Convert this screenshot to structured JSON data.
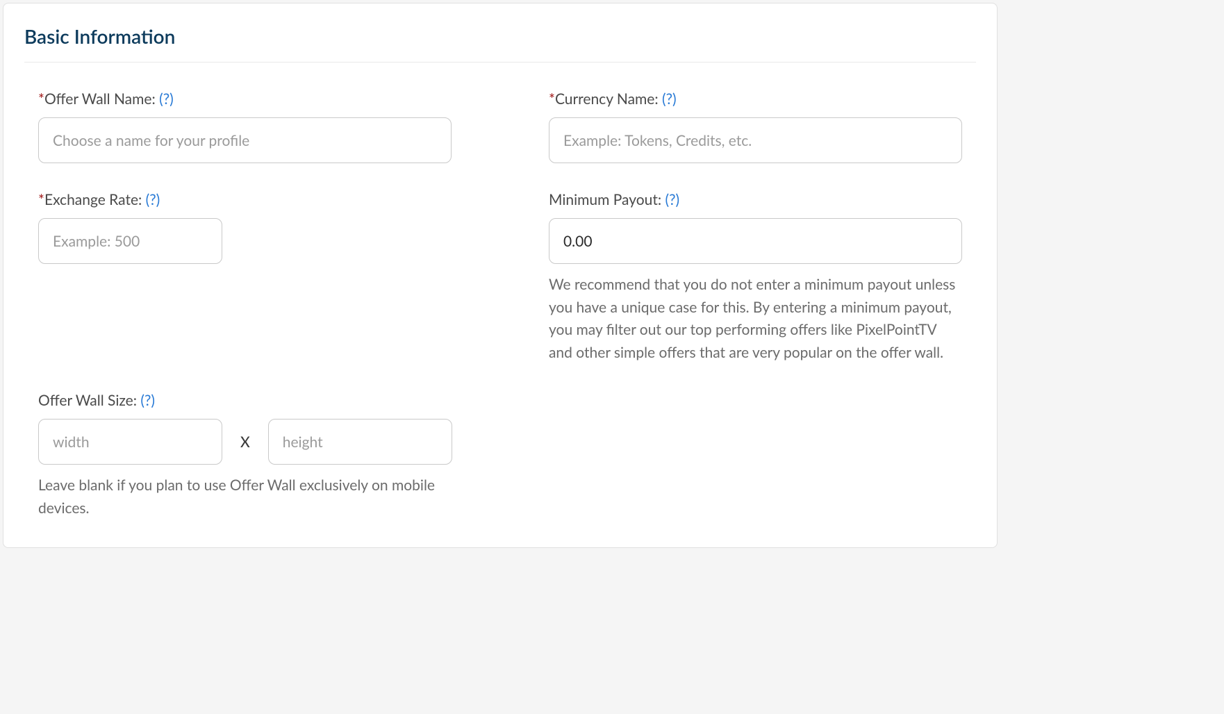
{
  "section": {
    "title": "Basic Information"
  },
  "required_symbol": "*",
  "help_symbol": "(?)",
  "fields": {
    "offer_wall_name": {
      "label": "Offer Wall Name:",
      "placeholder": "Choose a name for your profile",
      "value": ""
    },
    "currency_name": {
      "label": "Currency Name:",
      "placeholder": "Example: Tokens, Credits, etc.",
      "value": ""
    },
    "exchange_rate": {
      "label": "Exchange Rate:",
      "placeholder": "Example: 500",
      "value": ""
    },
    "minimum_payout": {
      "label": "Minimum Payout:",
      "value": "0.00",
      "helper": "We recommend that you do not enter a minimum payout unless you have a unique case for this. By entering a minimum payout, you may filter out our top performing offers like PixelPointTV and other simple offers that are very popular on the offer wall."
    },
    "offer_wall_size": {
      "label": "Offer Wall Size:",
      "width_placeholder": "width",
      "height_placeholder": "height",
      "separator": "X",
      "helper": "Leave blank if you plan to use Offer Wall exclusively on mobile devices."
    }
  }
}
